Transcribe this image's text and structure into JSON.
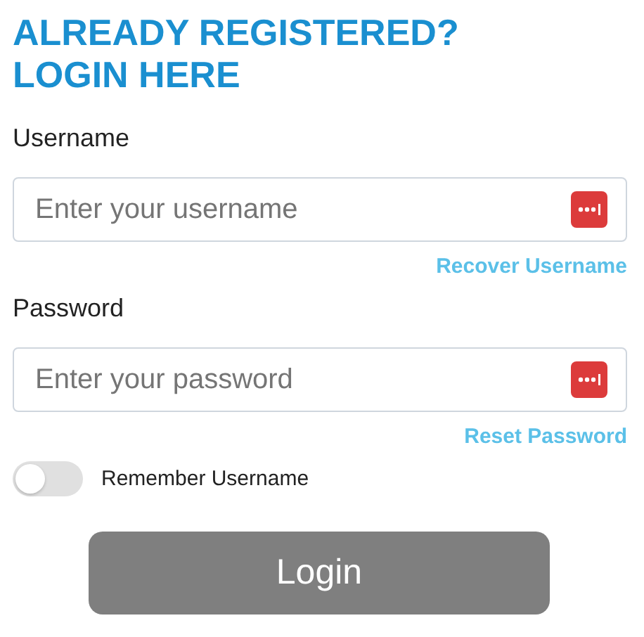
{
  "heading": [
    "ALREADY REGISTERED?",
    "LOGIN HERE"
  ],
  "fields": [
    {
      "label": "Username",
      "placeholder": "Enter your username",
      "link": "Recover Username"
    },
    {
      "label": "Password",
      "placeholder": "Enter your password",
      "link": "Reset Password"
    }
  ],
  "remember": {
    "label": "Remember Username",
    "on": false
  },
  "login_button": "Login"
}
